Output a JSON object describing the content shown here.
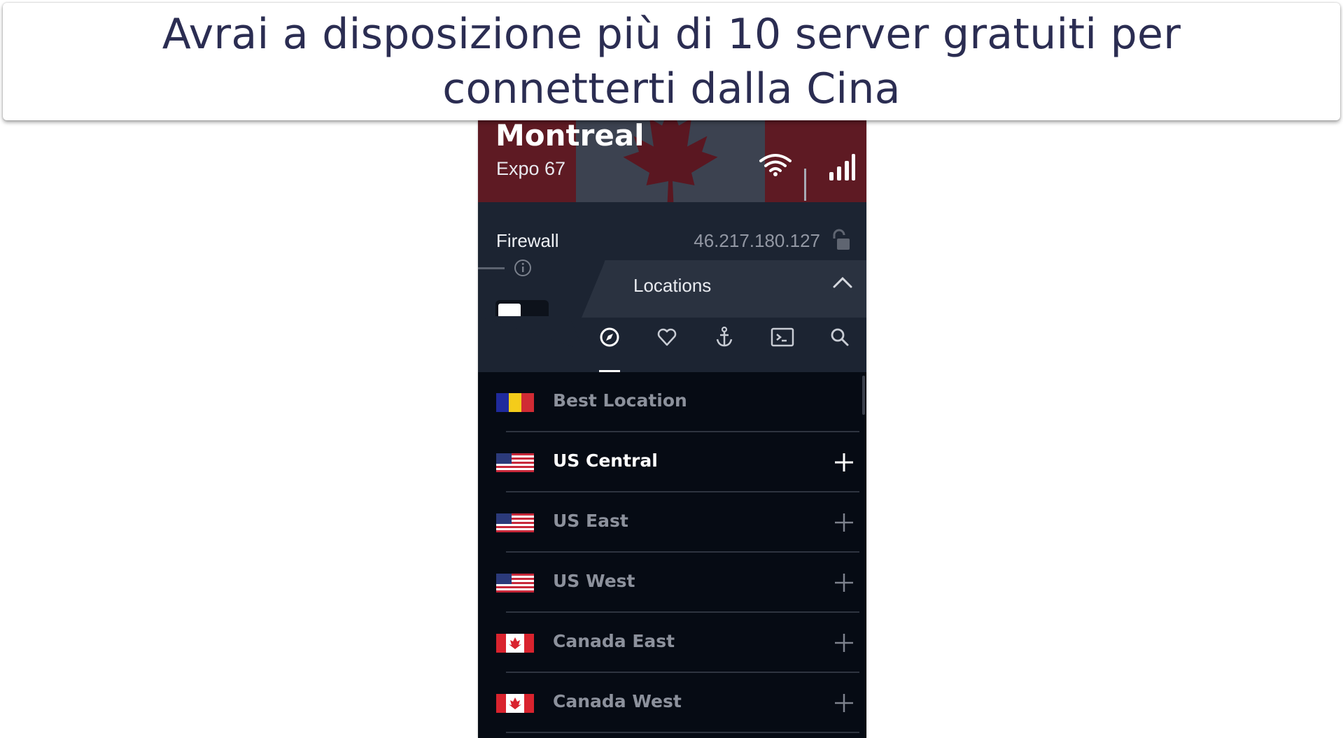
{
  "caption": {
    "text": "Avrai a disposizione più di 10 server gratuiti per connetterti dalla Cina"
  },
  "hero": {
    "city": "Montreal",
    "server": "Expo 67"
  },
  "status": {
    "firewall_label": "Firewall",
    "ip": "46.217.180.127",
    "firewall_enabled": false
  },
  "locations": {
    "title": "Locations",
    "tabs": [
      "compass-icon",
      "heart-icon",
      "anchor-icon",
      "terminal-icon",
      "search-icon"
    ],
    "active_tab": "compass-icon",
    "items": [
      {
        "label": "Best Location",
        "flag": "romania"
      },
      {
        "label": "US Central",
        "flag": "us"
      },
      {
        "label": "US East",
        "flag": "us"
      },
      {
        "label": "US West",
        "flag": "us"
      },
      {
        "label": "Canada East",
        "flag": "canada"
      },
      {
        "label": "Canada West",
        "flag": "canada"
      }
    ]
  },
  "colors": {
    "caption_text": "#2b2d52",
    "hero_bg": "#4a0d14",
    "panel_bg": "#1c2432",
    "list_bg": "#060b14"
  }
}
